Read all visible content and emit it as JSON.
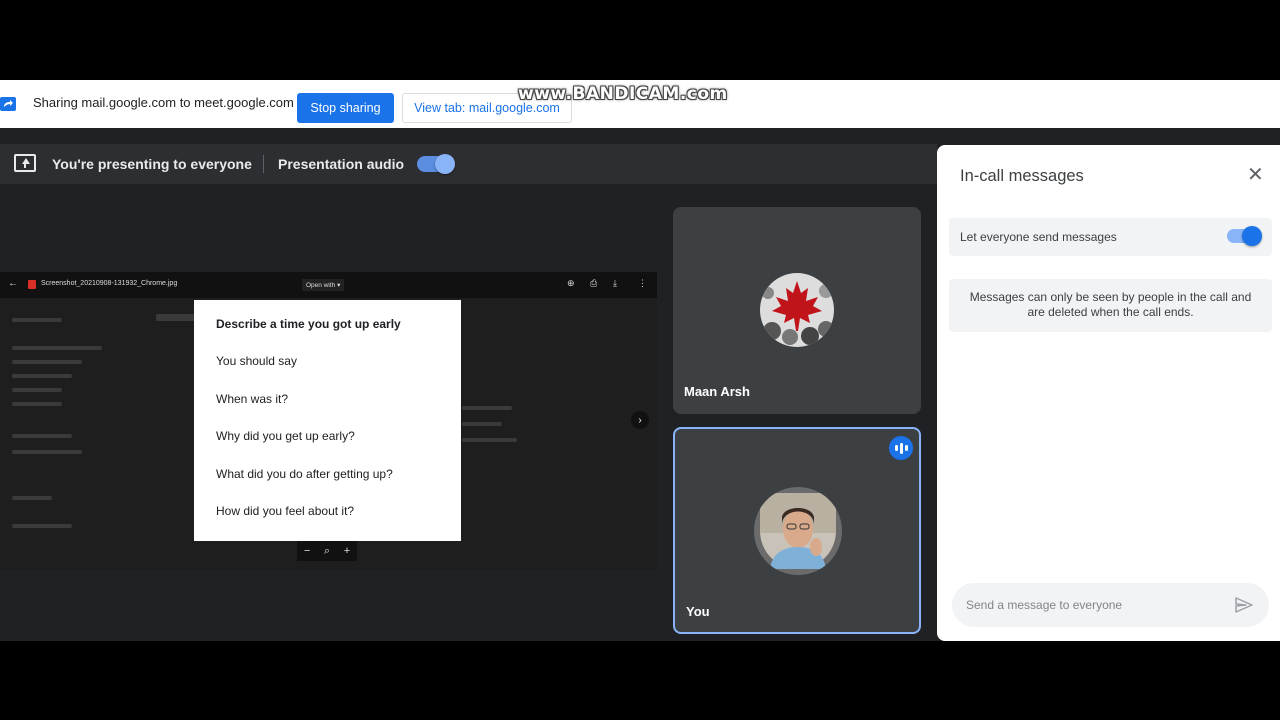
{
  "share_bar": {
    "text": "Sharing mail.google.com to meet.google.com",
    "stop_label": "Stop sharing",
    "view_label": "View tab: mail.google.com"
  },
  "watermark": "www.BANDICAM.com",
  "present_bar": {
    "status": "You're presenting to everyone",
    "audio_label": "Presentation audio",
    "audio_on": true
  },
  "shared_screen": {
    "file_name": "Screenshot_20210908-131932_Chrome.jpg",
    "open_with": "Open with",
    "card": {
      "title": "Describe a time you got up early",
      "lines": [
        "You should say",
        "When was it?",
        "Why did you get up early?",
        "What did you do after getting up?",
        "How did you feel about it?"
      ]
    }
  },
  "participants": [
    {
      "name": "Maan Arsh"
    },
    {
      "name": "You",
      "speaking": true
    }
  ],
  "chat": {
    "title": "In-call messages",
    "toggle_label": "Let everyone send messages",
    "toggle_on": true,
    "info": "Messages can only be seen by people in the call and are deleted when the call ends.",
    "placeholder": "Send a message to everyone"
  },
  "colors": {
    "accent": "#1a73e8",
    "toggle": "#8ab4f8",
    "meet_bg": "#202124",
    "tile_bg": "#3c4043"
  }
}
